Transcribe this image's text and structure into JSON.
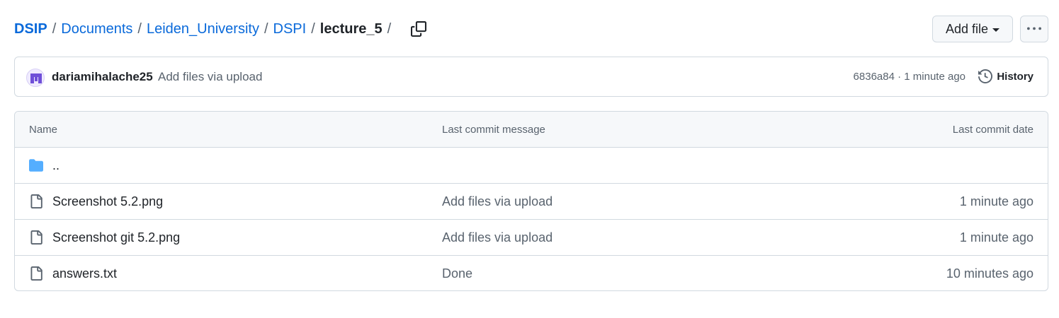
{
  "breadcrumb": {
    "items": [
      "DSIP",
      "Documents",
      "Leiden_University",
      "DSPI"
    ],
    "current": "lecture_5",
    "separator": "/",
    "copy_icon": "copy-icon"
  },
  "toolbar": {
    "add_file_label": "Add file",
    "more_icon": "kebab-horizontal-icon"
  },
  "latest_commit": {
    "author": "dariamihalache25",
    "message": "Add files via upload",
    "sha_time": "6836a84 · 1 minute ago",
    "history_label": "History"
  },
  "table": {
    "headers": {
      "name": "Name",
      "message": "Last commit message",
      "date": "Last commit date"
    },
    "parent": "..",
    "rows": [
      {
        "name": "Screenshot 5.2.png",
        "message": "Add files via upload",
        "date": "1 minute ago"
      },
      {
        "name": "Screenshot git 5.2.png",
        "message": "Add files via upload",
        "date": "1 minute ago"
      },
      {
        "name": "answers.txt",
        "message": "Done",
        "date": "10 minutes ago"
      }
    ]
  },
  "colors": {
    "link": "#0969da",
    "text": "#1f2328",
    "muted": "#59636e",
    "border": "#d1d9e0",
    "header_bg": "#f6f8fa",
    "folder": "#54aeff"
  }
}
